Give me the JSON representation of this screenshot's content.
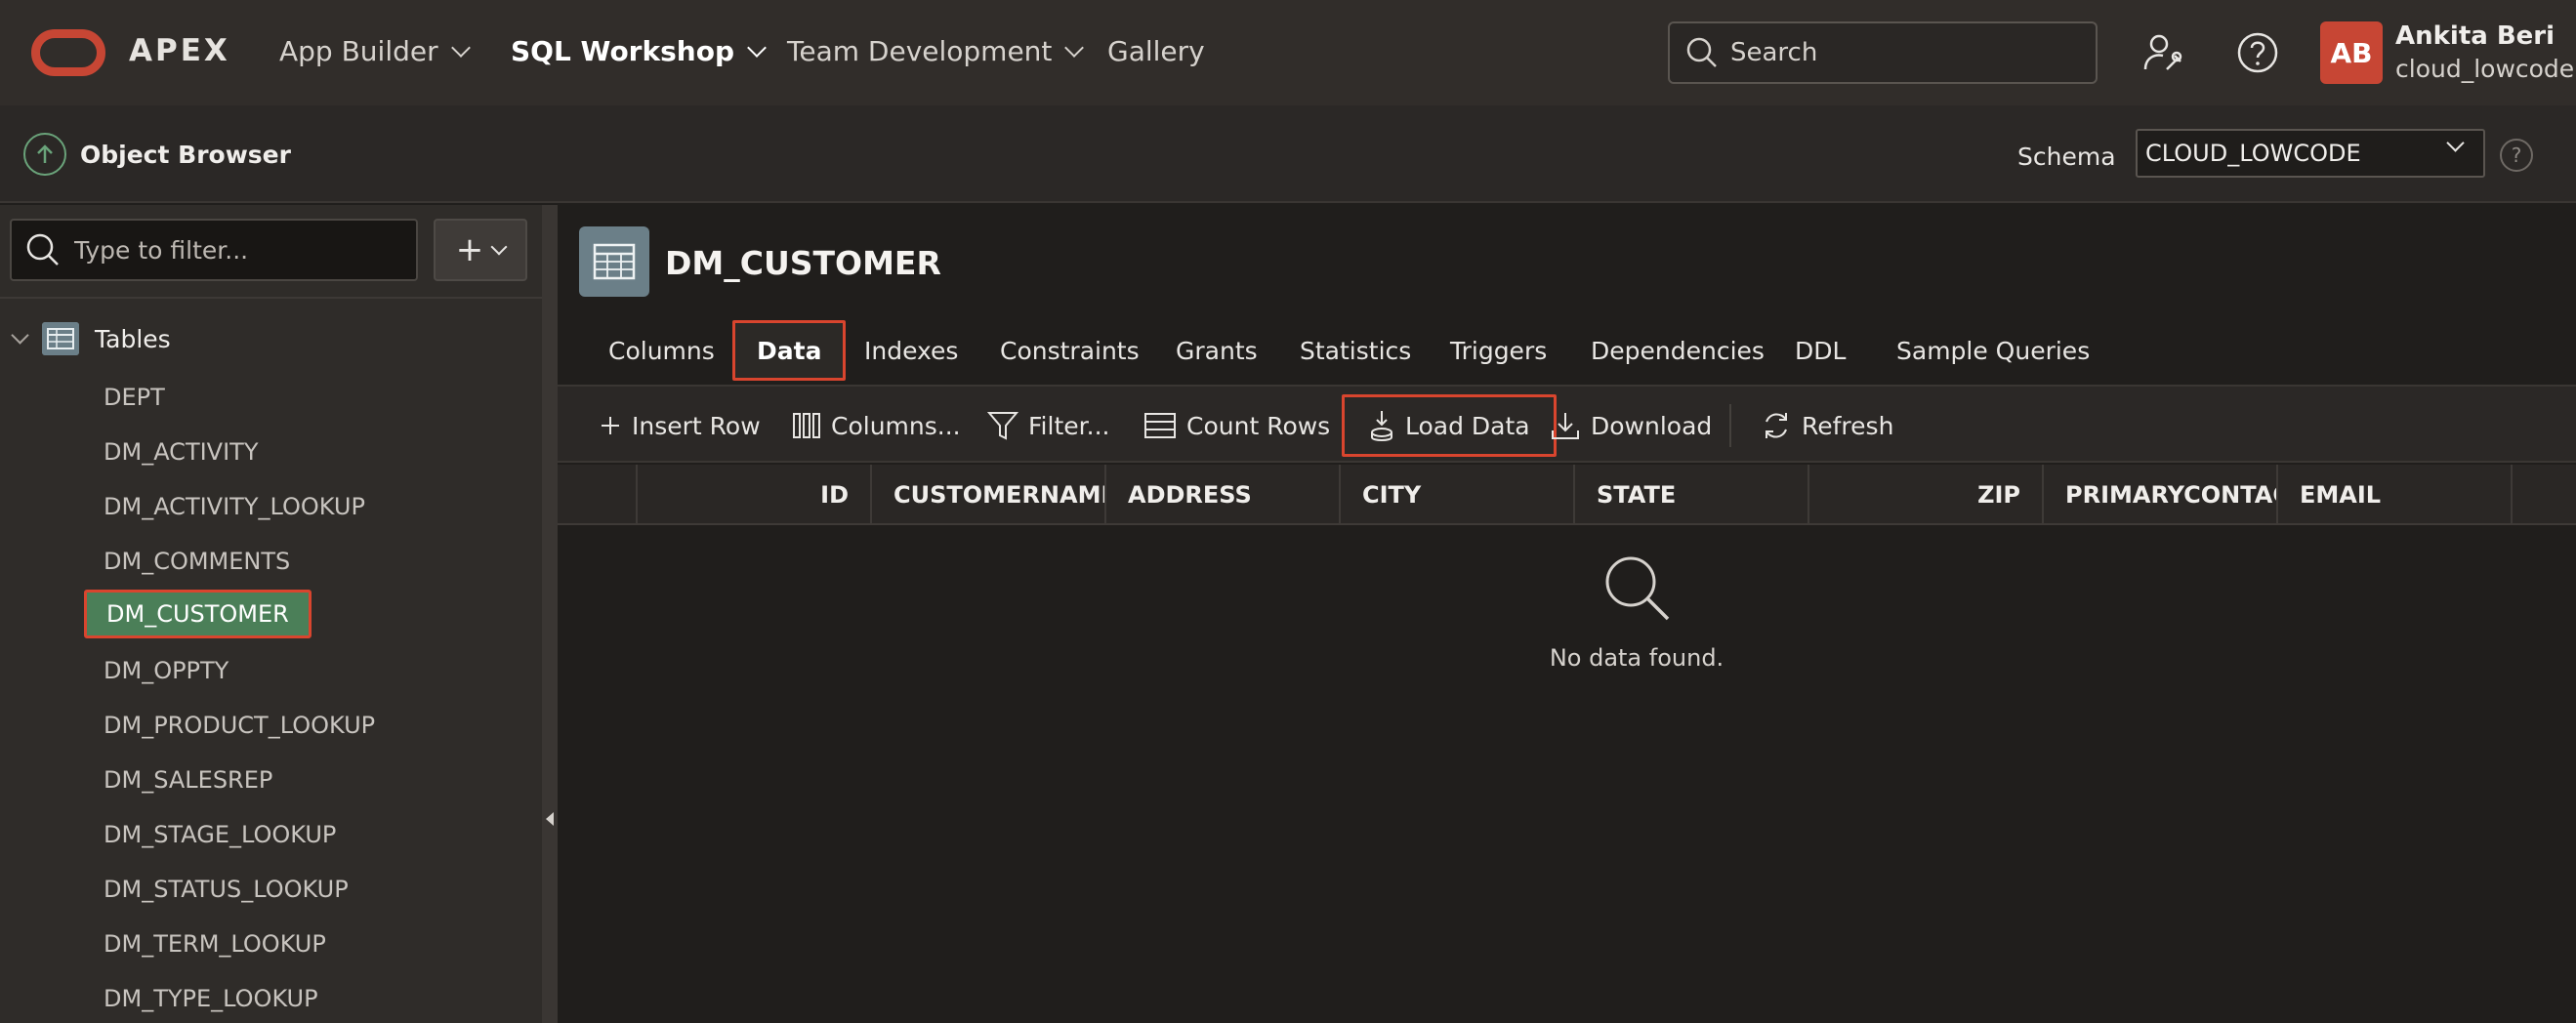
{
  "app": {
    "brand": "APEX",
    "nav": [
      {
        "label": "App Builder"
      },
      {
        "label": "SQL Workshop"
      },
      {
        "label": "Team Development"
      },
      {
        "label": "Gallery"
      }
    ],
    "search_placeholder": "Search",
    "user": {
      "initials": "AB",
      "name": "Ankita Beri",
      "schema": "cloud_lowcode"
    }
  },
  "subbar": {
    "title": "Object Browser",
    "schema_label": "Schema",
    "schema_value": "CLOUD_LOWCODE",
    "help_glyph": "?"
  },
  "sidebar": {
    "filter_placeholder": "Type to filter...",
    "add_glyph": "+",
    "root_label": "Tables",
    "items": [
      {
        "label": "DEPT"
      },
      {
        "label": "DM_ACTIVITY"
      },
      {
        "label": "DM_ACTIVITY_LOOKUP"
      },
      {
        "label": "DM_COMMENTS"
      },
      {
        "label": "DM_CUSTOMER"
      },
      {
        "label": "DM_OPPTY"
      },
      {
        "label": "DM_PRODUCT_LOOKUP"
      },
      {
        "label": "DM_SALESREP"
      },
      {
        "label": "DM_STAGE_LOOKUP"
      },
      {
        "label": "DM_STATUS_LOOKUP"
      },
      {
        "label": "DM_TERM_LOOKUP"
      },
      {
        "label": "DM_TYPE_LOOKUP"
      }
    ]
  },
  "object": {
    "title": "DM_CUSTOMER",
    "tabs": [
      {
        "label": "Columns"
      },
      {
        "label": "Data"
      },
      {
        "label": "Indexes"
      },
      {
        "label": "Constraints"
      },
      {
        "label": "Grants"
      },
      {
        "label": "Statistics"
      },
      {
        "label": "Triggers"
      },
      {
        "label": "Dependencies"
      },
      {
        "label": "DDL"
      },
      {
        "label": "Sample Queries"
      }
    ],
    "toolbar": {
      "insert_row": "Insert Row",
      "columns": "Columns...",
      "filter": "Filter...",
      "count_rows": "Count Rows",
      "load_data": "Load Data",
      "download": "Download",
      "refresh": "Refresh"
    },
    "grid": {
      "columns": [
        "ID",
        "CUSTOMERNAME",
        "ADDRESS",
        "CITY",
        "STATE",
        "ZIP",
        "PRIMARYCONTACT",
        "EMAIL"
      ],
      "empty_message": "No data found."
    }
  },
  "colors": {
    "topbar": "#312d2a",
    "brand_red": "#c74634",
    "selected_green": "#4b7f58",
    "highlight_border": "#d9452e"
  }
}
